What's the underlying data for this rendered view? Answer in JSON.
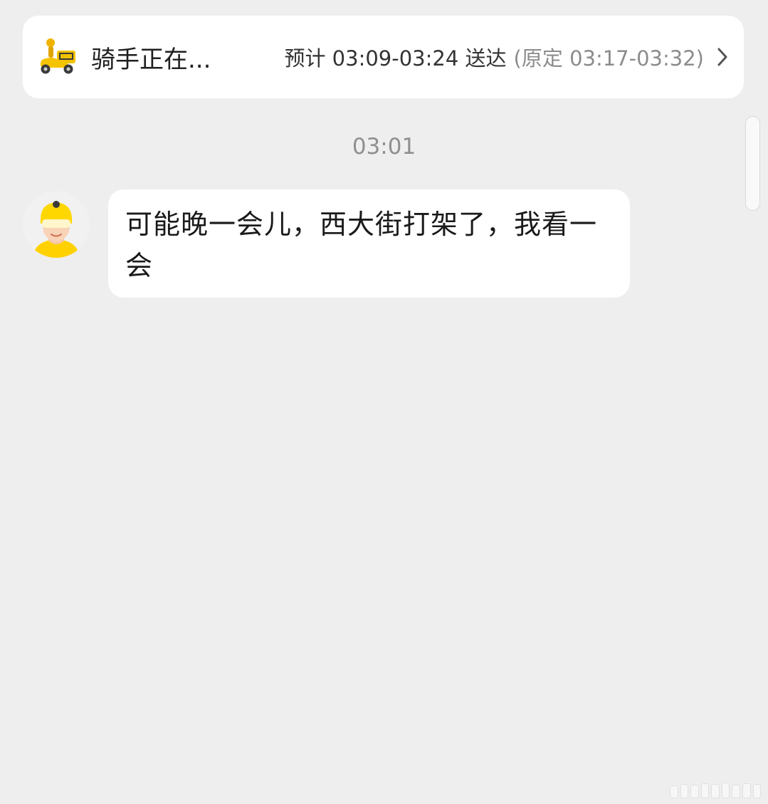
{
  "status_card": {
    "icon": "rider-scooter-icon",
    "title": "骑手正在...",
    "eta": "预计 03:09-03:24 送达",
    "original_eta": "(原定 03:17-03:32)",
    "chevron": "chevron-right-icon"
  },
  "chat": {
    "timestamp": "03:01",
    "messages": [
      {
        "sender": "rider",
        "avatar": "rider-avatar-icon",
        "text": "可能晚一会儿，西大街打架了，我看一会"
      }
    ]
  },
  "colors": {
    "background": "#eeeeee",
    "card": "#ffffff",
    "accent_yellow": "#ffd100",
    "muted_text": "#8f8f8f"
  }
}
